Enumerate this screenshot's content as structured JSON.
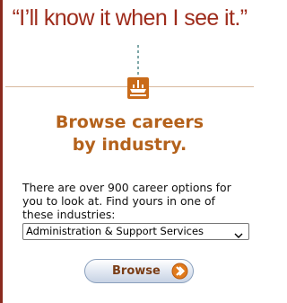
{
  "quote": "“I’ll know it when I see it.”",
  "icon": "industry-icon",
  "heading_line1": "Browse careers",
  "heading_line2": "by industry.",
  "description": "There are over 900 career options for you to look at. Find yours in one of these industries:",
  "industry_select": {
    "selected": "Administration & Support Services"
  },
  "browse_button": {
    "label": "Browse"
  },
  "colors": {
    "quote": "#9e2c1c",
    "heading": "#b4621c",
    "icon_bg": "#c96b1a",
    "button_text": "#7a3d16"
  }
}
